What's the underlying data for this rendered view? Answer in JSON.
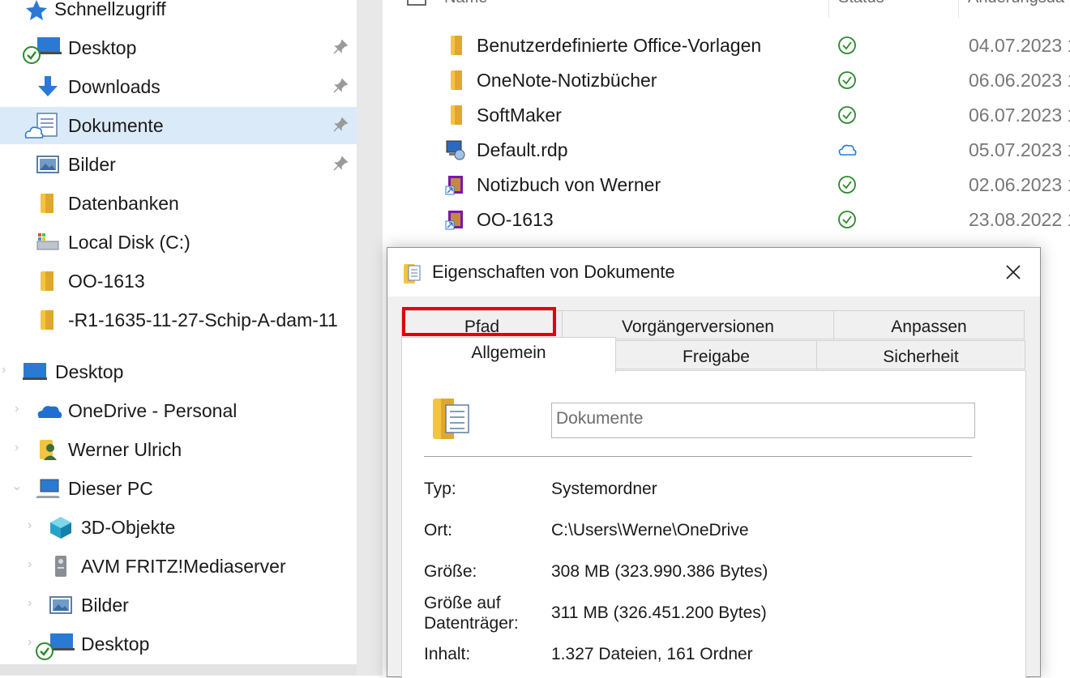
{
  "sidebar": {
    "quick_access": [
      {
        "label": "Schnellzugriff"
      },
      {
        "label": "Desktop"
      },
      {
        "label": "Downloads"
      },
      {
        "label": "Dokumente"
      },
      {
        "label": "Bilder"
      },
      {
        "label": "Datenbanken"
      },
      {
        "label": "Local Disk (C:)"
      },
      {
        "label": "OO-1613"
      },
      {
        "label": "-R1-1635-11-27-Schip-A-dam-11"
      }
    ],
    "tree": [
      {
        "label": "Desktop"
      },
      {
        "label": "OneDrive - Personal"
      },
      {
        "label": "Werner Ulrich"
      },
      {
        "label": "Dieser PC"
      },
      {
        "label": "3D-Objekte"
      },
      {
        "label": "AVM FRITZ!Mediaserver"
      },
      {
        "label": "Bilder"
      },
      {
        "label": "Desktop"
      }
    ]
  },
  "file_list": {
    "columns": [
      "Name",
      "Status",
      "Änderungsda"
    ],
    "rows": [
      {
        "name": "Benutzerdefinierte Office-Vorlagen",
        "date": "04.07.2023 1",
        "icon": "folder-icon",
        "status": "synced-check-icon"
      },
      {
        "name": "OneNote-Notizbücher",
        "date": "06.06.2023 1",
        "icon": "folder-icon",
        "status": "synced-check-icon"
      },
      {
        "name": "SoftMaker",
        "date": "06.07.2023 1",
        "icon": "folder-icon",
        "status": "synced-check-icon"
      },
      {
        "name": "Default.rdp",
        "date": "05.07.2023 1",
        "icon": "rdp-file-icon",
        "status": "cloud-icon"
      },
      {
        "name": "Notizbuch von Werner",
        "date": "02.06.2023 1",
        "icon": "onenote-shortcut-icon",
        "status": "synced-check-icon"
      },
      {
        "name": "OO-1613",
        "date": "23.08.2022 1",
        "icon": "onenote-shortcut-icon",
        "status": "synced-check-icon"
      }
    ]
  },
  "dialog": {
    "title": "Eigenschaften von Dokumente",
    "tabs_back": [
      "Pfad",
      "Vorgängerversionen",
      "Anpassen"
    ],
    "tabs_front": [
      "Allgemein",
      "Freigabe",
      "Sicherheit"
    ],
    "active_tab": "Allgemein",
    "highlighted_tab": "Pfad",
    "name_value": "Dokumente",
    "props": [
      {
        "label": "Typ:",
        "value": "Systemordner"
      },
      {
        "label": "Ort:",
        "value": "C:\\Users\\Werne\\OneDrive"
      },
      {
        "label": "Größe:",
        "value": "308 MB (323.990.386 Bytes)"
      },
      {
        "label": "Größe auf\nDatenträger:",
        "value": "311 MB (326.451.200 Bytes)"
      },
      {
        "label": "Inhalt:",
        "value": "1.327 Dateien, 161 Ordner"
      }
    ]
  },
  "colors": {
    "selection": "#dbeaf8",
    "accent": "#2a7ad4",
    "sync_green": "#2a8a2a",
    "highlight_red": "#e0000f"
  }
}
